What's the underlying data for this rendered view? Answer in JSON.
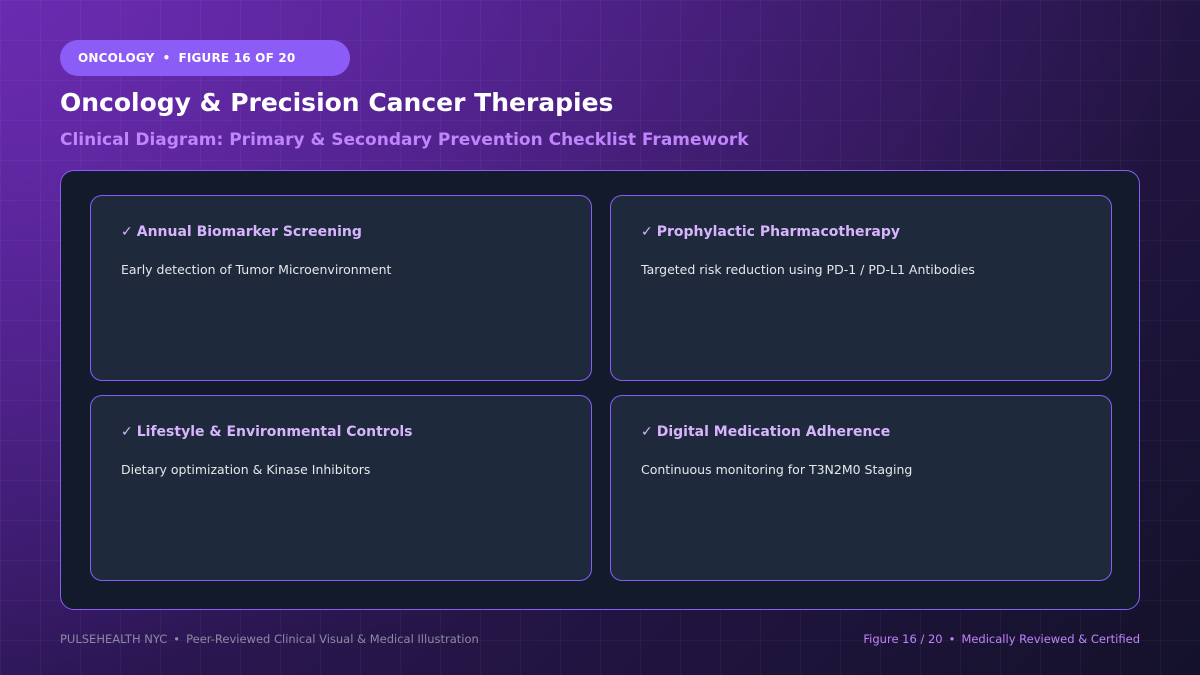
{
  "badge": {
    "category": "ONCOLOGY",
    "separator": "•",
    "figure": "FIGURE 16 OF 20"
  },
  "header": {
    "title": "Oncology & Precision Cancer Therapies",
    "subtitle": "Clinical Diagram: Primary & Secondary Prevention Checklist Framework"
  },
  "check_icon": "✓",
  "cards": [
    {
      "title": "Annual Biomarker Screening",
      "description": "Early detection of Tumor Microenvironment"
    },
    {
      "title": "Prophylactic Pharmacotherapy",
      "description": "Targeted risk reduction using PD-1 / PD-L1 Antibodies"
    },
    {
      "title": "Lifestyle & Environmental Controls",
      "description": "Dietary optimization & Kinase Inhibitors"
    },
    {
      "title": "Digital Medication Adherence",
      "description": "Continuous monitoring for T3N2M0 Staging"
    }
  ],
  "footer": {
    "brand": "PULSEHEALTH NYC",
    "separator": "•",
    "tagline": "Peer-Reviewed Clinical Visual & Medical Illustration",
    "figure": "Figure 16 / 20",
    "certification": "Medically Reviewed & Certified"
  },
  "colors": {
    "accent": "#8b5cf6",
    "accent_text": "#c084fc",
    "card_bg": "#1e2a3b",
    "panel_bg": "#131a2b"
  }
}
